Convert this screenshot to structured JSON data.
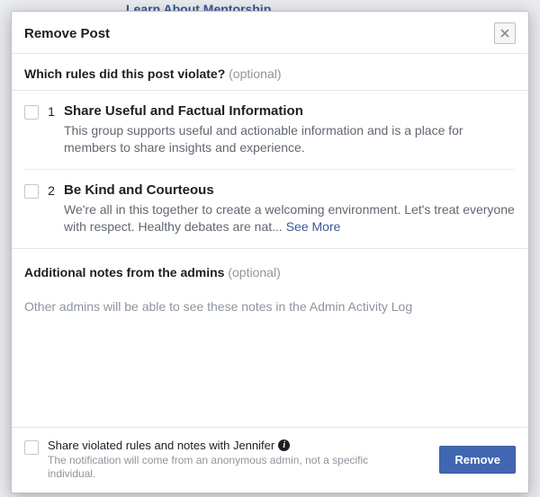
{
  "background": {
    "link": "Learn About Mentorship"
  },
  "modal": {
    "title": "Remove Post",
    "section_rules_label": "Which rules did this post violate?",
    "optional_label": "(optional)",
    "rules": [
      {
        "num": "1",
        "title": "Share Useful and Factual Information",
        "desc": "This group supports useful and actionable information and is a place for members to share insights and experience."
      },
      {
        "num": "2",
        "title": "Be Kind and Courteous",
        "desc": "We're all in this together to create a welcoming environment. Let's treat everyone with respect. Healthy debates are nat... ",
        "see_more": "See More"
      }
    ],
    "notes_label": "Additional notes from the admins",
    "notes_placeholder": "Other admins will be able to see these notes in the Admin Activity Log",
    "footer": {
      "checkbox_label": "Share violated rules and notes with Jennifer",
      "subtext": "The notification will come from an anonymous admin, not a specific individual.",
      "remove_label": "Remove"
    }
  }
}
